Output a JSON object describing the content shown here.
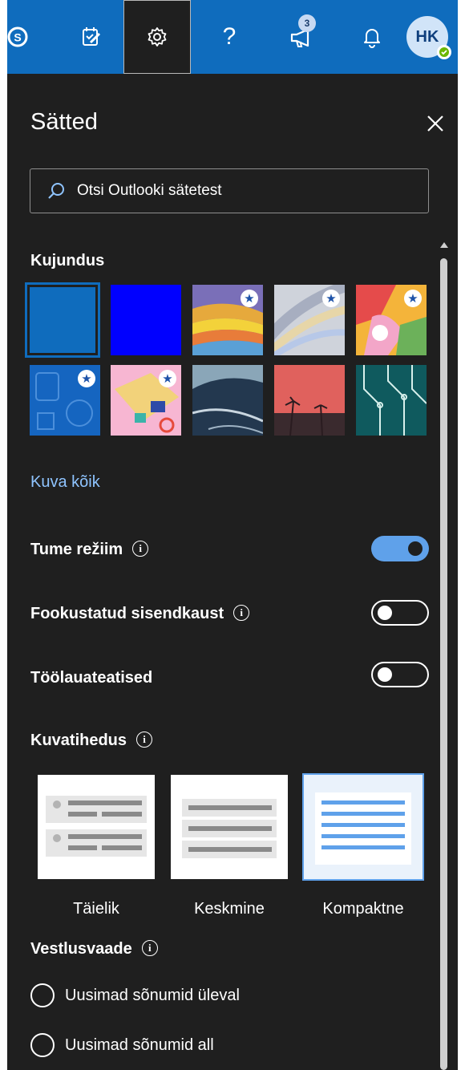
{
  "topbar": {
    "accent": "#0f6cbd",
    "icons": [
      "skype-icon",
      "todo-icon",
      "gear-icon",
      "help-icon",
      "megaphone-icon",
      "bell-icon"
    ],
    "help_label": "?",
    "notification_badge": "3",
    "avatar_initials": "HK",
    "presence_status": "available"
  },
  "panel": {
    "title": "Sätted",
    "search_placeholder": "Otsi Outlooki sätetest",
    "theme": {
      "heading": "Kujundus",
      "selected_index": 0,
      "show_all_link": "Kuva kõik",
      "tiles": [
        {
          "name": "theme-blue",
          "color": "#0f6cbd",
          "premium": false
        },
        {
          "name": "theme-bright-blue",
          "color": "#0000ff",
          "premium": false
        },
        {
          "name": "theme-waves",
          "premium": true
        },
        {
          "name": "theme-ribbons",
          "premium": true
        },
        {
          "name": "theme-abstract-art",
          "premium": true
        },
        {
          "name": "theme-school",
          "premium": true
        },
        {
          "name": "theme-board-game",
          "premium": true
        },
        {
          "name": "theme-ocean",
          "premium": false
        },
        {
          "name": "theme-palms",
          "premium": false
        },
        {
          "name": "theme-circuit",
          "premium": false
        }
      ]
    },
    "dark_mode": {
      "label": "Tume režiim",
      "on": true
    },
    "focused_inbox": {
      "label": "Fookustatud sisendkaust",
      "on": false
    },
    "desktop_notifications": {
      "label": "Töölauateatised",
      "on": false
    },
    "density": {
      "heading": "Kuvatihedus",
      "selected": "Kompaktne",
      "options": [
        "Täielik",
        "Keskmine",
        "Kompaktne"
      ]
    },
    "conversation_view": {
      "heading": "Vestlusvaade",
      "options": [
        "Uusimad sõnumid üleval",
        "Uusimad sõnumid all"
      ]
    }
  }
}
